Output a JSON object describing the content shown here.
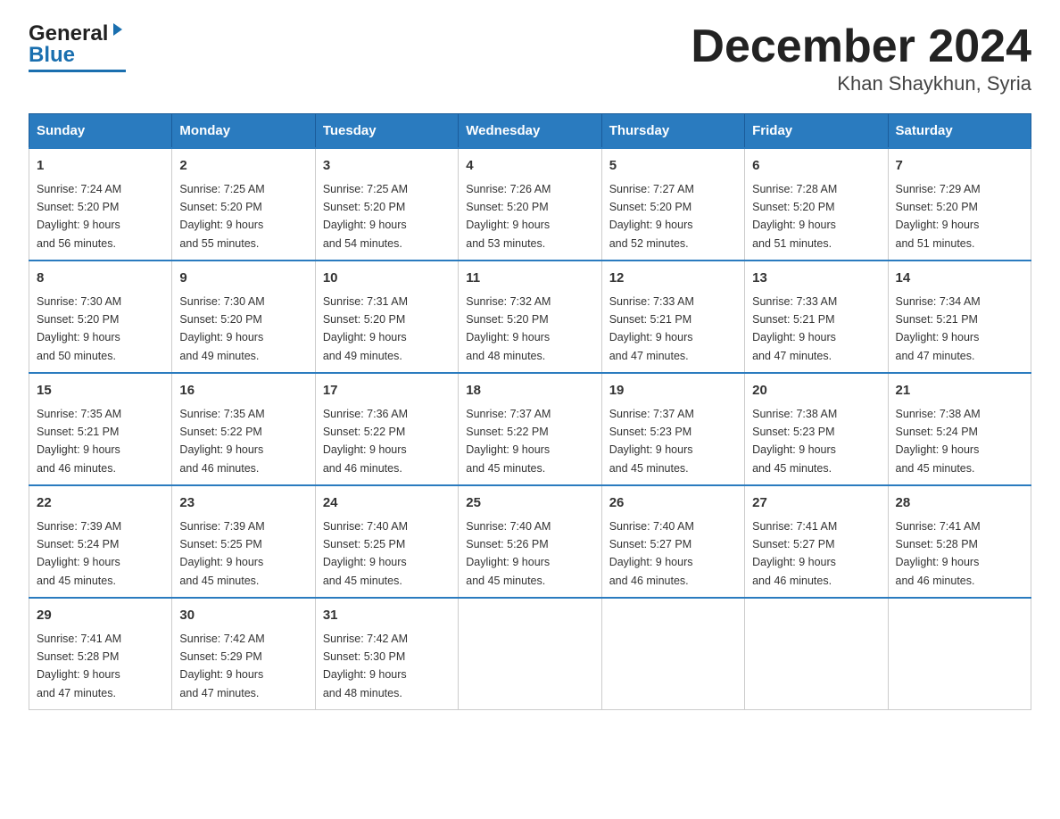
{
  "header": {
    "logo_general": "General",
    "logo_blue": "Blue",
    "title": "December 2024",
    "subtitle": "Khan Shaykhun, Syria"
  },
  "calendar": {
    "days_of_week": [
      "Sunday",
      "Monday",
      "Tuesday",
      "Wednesday",
      "Thursday",
      "Friday",
      "Saturday"
    ],
    "weeks": [
      [
        {
          "day": "1",
          "sunrise": "7:24 AM",
          "sunset": "5:20 PM",
          "daylight": "9 hours and 56 minutes."
        },
        {
          "day": "2",
          "sunrise": "7:25 AM",
          "sunset": "5:20 PM",
          "daylight": "9 hours and 55 minutes."
        },
        {
          "day": "3",
          "sunrise": "7:25 AM",
          "sunset": "5:20 PM",
          "daylight": "9 hours and 54 minutes."
        },
        {
          "day": "4",
          "sunrise": "7:26 AM",
          "sunset": "5:20 PM",
          "daylight": "9 hours and 53 minutes."
        },
        {
          "day": "5",
          "sunrise": "7:27 AM",
          "sunset": "5:20 PM",
          "daylight": "9 hours and 52 minutes."
        },
        {
          "day": "6",
          "sunrise": "7:28 AM",
          "sunset": "5:20 PM",
          "daylight": "9 hours and 51 minutes."
        },
        {
          "day": "7",
          "sunrise": "7:29 AM",
          "sunset": "5:20 PM",
          "daylight": "9 hours and 51 minutes."
        }
      ],
      [
        {
          "day": "8",
          "sunrise": "7:30 AM",
          "sunset": "5:20 PM",
          "daylight": "9 hours and 50 minutes."
        },
        {
          "day": "9",
          "sunrise": "7:30 AM",
          "sunset": "5:20 PM",
          "daylight": "9 hours and 49 minutes."
        },
        {
          "day": "10",
          "sunrise": "7:31 AM",
          "sunset": "5:20 PM",
          "daylight": "9 hours and 49 minutes."
        },
        {
          "day": "11",
          "sunrise": "7:32 AM",
          "sunset": "5:20 PM",
          "daylight": "9 hours and 48 minutes."
        },
        {
          "day": "12",
          "sunrise": "7:33 AM",
          "sunset": "5:21 PM",
          "daylight": "9 hours and 47 minutes."
        },
        {
          "day": "13",
          "sunrise": "7:33 AM",
          "sunset": "5:21 PM",
          "daylight": "9 hours and 47 minutes."
        },
        {
          "day": "14",
          "sunrise": "7:34 AM",
          "sunset": "5:21 PM",
          "daylight": "9 hours and 47 minutes."
        }
      ],
      [
        {
          "day": "15",
          "sunrise": "7:35 AM",
          "sunset": "5:21 PM",
          "daylight": "9 hours and 46 minutes."
        },
        {
          "day": "16",
          "sunrise": "7:35 AM",
          "sunset": "5:22 PM",
          "daylight": "9 hours and 46 minutes."
        },
        {
          "day": "17",
          "sunrise": "7:36 AM",
          "sunset": "5:22 PM",
          "daylight": "9 hours and 46 minutes."
        },
        {
          "day": "18",
          "sunrise": "7:37 AM",
          "sunset": "5:22 PM",
          "daylight": "9 hours and 45 minutes."
        },
        {
          "day": "19",
          "sunrise": "7:37 AM",
          "sunset": "5:23 PM",
          "daylight": "9 hours and 45 minutes."
        },
        {
          "day": "20",
          "sunrise": "7:38 AM",
          "sunset": "5:23 PM",
          "daylight": "9 hours and 45 minutes."
        },
        {
          "day": "21",
          "sunrise": "7:38 AM",
          "sunset": "5:24 PM",
          "daylight": "9 hours and 45 minutes."
        }
      ],
      [
        {
          "day": "22",
          "sunrise": "7:39 AM",
          "sunset": "5:24 PM",
          "daylight": "9 hours and 45 minutes."
        },
        {
          "day": "23",
          "sunrise": "7:39 AM",
          "sunset": "5:25 PM",
          "daylight": "9 hours and 45 minutes."
        },
        {
          "day": "24",
          "sunrise": "7:40 AM",
          "sunset": "5:25 PM",
          "daylight": "9 hours and 45 minutes."
        },
        {
          "day": "25",
          "sunrise": "7:40 AM",
          "sunset": "5:26 PM",
          "daylight": "9 hours and 45 minutes."
        },
        {
          "day": "26",
          "sunrise": "7:40 AM",
          "sunset": "5:27 PM",
          "daylight": "9 hours and 46 minutes."
        },
        {
          "day": "27",
          "sunrise": "7:41 AM",
          "sunset": "5:27 PM",
          "daylight": "9 hours and 46 minutes."
        },
        {
          "day": "28",
          "sunrise": "7:41 AM",
          "sunset": "5:28 PM",
          "daylight": "9 hours and 46 minutes."
        }
      ],
      [
        {
          "day": "29",
          "sunrise": "7:41 AM",
          "sunset": "5:28 PM",
          "daylight": "9 hours and 47 minutes."
        },
        {
          "day": "30",
          "sunrise": "7:42 AM",
          "sunset": "5:29 PM",
          "daylight": "9 hours and 47 minutes."
        },
        {
          "day": "31",
          "sunrise": "7:42 AM",
          "sunset": "5:30 PM",
          "daylight": "9 hours and 48 minutes."
        },
        null,
        null,
        null,
        null
      ]
    ],
    "labels": {
      "sunrise": "Sunrise:",
      "sunset": "Sunset:",
      "daylight": "Daylight:"
    }
  }
}
